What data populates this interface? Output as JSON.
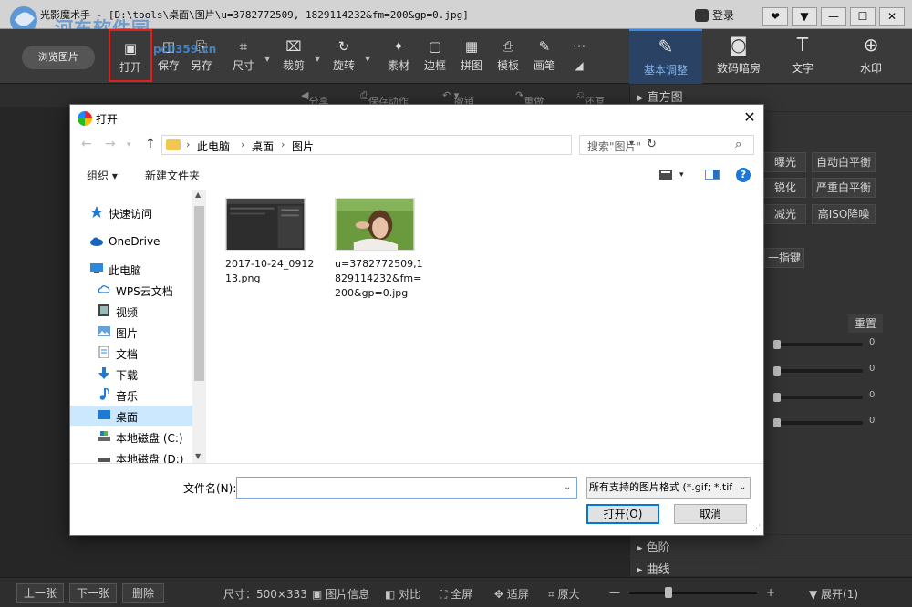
{
  "app": {
    "title": "光影魔术手 - [D:\\tools\\桌面\\图片\\u=3782772509, 1829114232&fm=200&gp=0.jpg]",
    "watermark_text": "河东软件园",
    "watermark_url": "pc0359.cn",
    "login_label": "登录",
    "window_buttons": [
      "❤",
      "▼",
      "—",
      "☐",
      "✕"
    ]
  },
  "toolbar": {
    "browse_label": "浏览图片",
    "tools": [
      {
        "label": "打开",
        "icon": "open-image-icon",
        "glyph": "▣"
      },
      {
        "label": "保存",
        "icon": "save-icon",
        "glyph": "◫"
      },
      {
        "label": "另存",
        "icon": "save-as-icon",
        "glyph": "⎘"
      },
      {
        "label": "尺寸",
        "icon": "resize-icon",
        "glyph": "⌗"
      },
      {
        "label": "裁剪",
        "icon": "crop-icon",
        "glyph": "⌧"
      },
      {
        "label": "旋转",
        "icon": "rotate-icon",
        "glyph": "↻"
      },
      {
        "label": "素材",
        "icon": "stickers-icon",
        "glyph": "✦"
      },
      {
        "label": "边框",
        "icon": "frame-icon",
        "glyph": "▢"
      },
      {
        "label": "拼图",
        "icon": "collage-icon",
        "glyph": "▦"
      },
      {
        "label": "模板",
        "icon": "template-icon",
        "glyph": "⎙"
      },
      {
        "label": "画笔",
        "icon": "brush-icon",
        "glyph": "✎"
      }
    ],
    "more_glyph": "···",
    "right_tools": [
      {
        "label": "基本调整",
        "icon": "basic-adjust-icon",
        "glyph": "✎"
      },
      {
        "label": "数码暗房",
        "icon": "darkroom-icon",
        "glyph": "◙"
      },
      {
        "label": "文字",
        "icon": "text-icon",
        "glyph": "T"
      },
      {
        "label": "水印",
        "icon": "watermark-icon",
        "glyph": "⊕"
      }
    ]
  },
  "subbar": {
    "share": "分享",
    "save_action": "保存动作",
    "undo": "撤销",
    "redo": "重做",
    "restore": "还原"
  },
  "panel": {
    "histogram": "直方图",
    "buttons": [
      "曝光",
      "自动白平衡",
      "锐化",
      "严重白平衡",
      "减光",
      "高ISO降噪"
    ],
    "one_key": "一指键",
    "reset": "重置",
    "slider_values": [
      "0",
      "0",
      "0",
      "0"
    ],
    "levels": "色阶",
    "curves": "曲线"
  },
  "bottombar": {
    "prev": "上一张",
    "next": "下一张",
    "delete": "删除",
    "size": "尺寸：500×333",
    "info": "图片信息",
    "compare": "对比",
    "fullscreen": "全屏",
    "fit": "适屏",
    "original": "原大",
    "minus": "—",
    "plus": "+",
    "expand": "展开(1)"
  },
  "dialog": {
    "title": "打开",
    "breadcrumb": [
      "此电脑",
      "桌面",
      "图片"
    ],
    "search_placeholder": "搜索\"图片\"",
    "organize": "组织 ▾",
    "new_folder": "新建文件夹",
    "nav": [
      {
        "label": "快速访问",
        "icon": "star-icon",
        "top": true
      },
      {
        "label": "OneDrive",
        "icon": "cloud-icon",
        "top": true
      },
      {
        "label": "此电脑",
        "icon": "computer-icon",
        "top": true
      },
      {
        "label": "WPS云文档",
        "icon": "cloud-outline-icon",
        "top": false
      },
      {
        "label": "视频",
        "icon": "video-icon",
        "top": false
      },
      {
        "label": "图片",
        "icon": "pictures-icon",
        "top": false
      },
      {
        "label": "文档",
        "icon": "documents-icon",
        "top": false
      },
      {
        "label": "下载",
        "icon": "download-icon",
        "top": false
      },
      {
        "label": "音乐",
        "icon": "music-icon",
        "top": false
      },
      {
        "label": "桌面",
        "icon": "desktop-icon",
        "top": false,
        "selected": true
      },
      {
        "label": "本地磁盘 (C:)",
        "icon": "drive-icon",
        "top": false
      },
      {
        "label": "本地磁盘 (D:)",
        "icon": "drive-icon",
        "top": false
      }
    ],
    "files": [
      {
        "name": "2017-10-24_091213.png"
      },
      {
        "name": "u=3782772509,1829114232&fm=200&gp=0.jpg"
      }
    ],
    "filename_label": "文件名(N):",
    "filename_value": "",
    "filter": "所有支持的图片格式 (*.gif; *.tif",
    "open_button": "打开(O)",
    "cancel_button": "取消"
  },
  "colors": {
    "accent": "#0078d7",
    "highlight_box": "#e0201d",
    "selected_nav": "#cce8ff",
    "app_dark": "#2b2b2b"
  }
}
